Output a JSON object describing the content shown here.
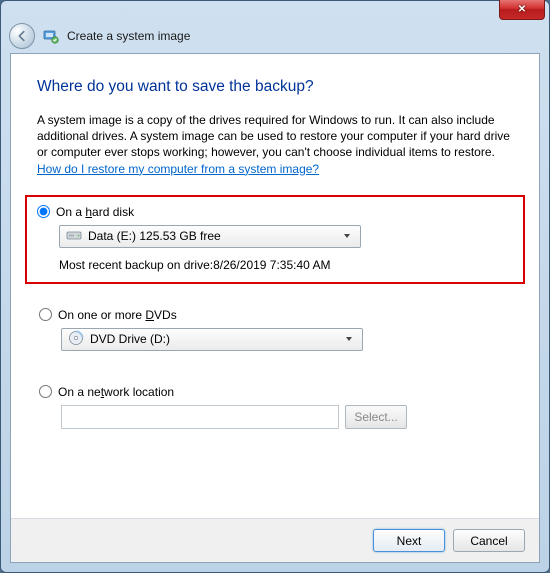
{
  "window": {
    "title": "Create a system image"
  },
  "heading": "Where do you want to save the backup?",
  "description": {
    "text_before_link": "A system image is a copy of the drives required for Windows to run. It can also include additional drives. A system image can be used to restore your computer if your hard drive or computer ever stops working; however, you can't choose individual items to restore. ",
    "link_text": "How do I restore my computer from a system image?"
  },
  "options": {
    "hard_disk": {
      "label_pre": "On a ",
      "label_accel": "h",
      "label_post": "ard disk",
      "selected_drive": "Data (E:)  125.53 GB free",
      "status": "Most recent backup on drive:8/26/2019 7:35:40 AM"
    },
    "dvds": {
      "label_pre": "On one or more ",
      "label_accel": "D",
      "label_post": "VDs",
      "selected_drive": "DVD Drive (D:)"
    },
    "network": {
      "label_pre": "On a ne",
      "label_accel": "t",
      "label_post": "work location",
      "value": "",
      "select_button": "Select..."
    }
  },
  "footer": {
    "next": "Next",
    "cancel": "Cancel"
  }
}
